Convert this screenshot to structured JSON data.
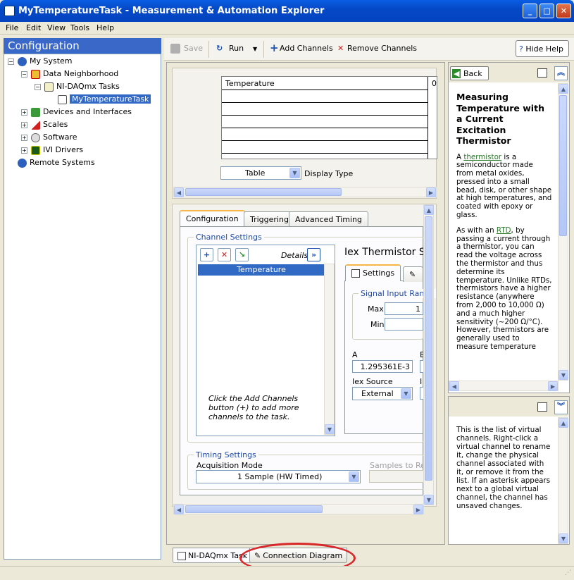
{
  "window": {
    "title": "MyTemperatureTask - Measurement & Automation Explorer"
  },
  "menu": [
    "File",
    "Edit",
    "View",
    "Tools",
    "Help"
  ],
  "left": {
    "header": "Configuration",
    "tree": [
      {
        "label": "My System",
        "icon": "system-icon"
      },
      {
        "label": "Data Neighborhood",
        "icon": "data-neighborhood-icon"
      },
      {
        "label": "NI-DAQmx Tasks",
        "icon": "daqmx-tasks-icon"
      },
      {
        "label": "MyTemperatureTask",
        "icon": "task-icon"
      },
      {
        "label": "Devices and Interfaces",
        "icon": "devices-icon"
      },
      {
        "label": "Scales",
        "icon": "scales-icon"
      },
      {
        "label": "Software",
        "icon": "software-icon"
      },
      {
        "label": "IVI Drivers",
        "icon": "ivi-icon"
      },
      {
        "label": "Remote Systems",
        "icon": "remote-systems-icon"
      }
    ]
  },
  "toolbar": {
    "save": "Save",
    "run": "Run",
    "add_channels": "Add Channels",
    "remove_channels": "Remove Channels",
    "hide_help": "Hide Help"
  },
  "display": {
    "column_header": "Temperature",
    "column_value": "0",
    "display_type_value": "Table",
    "display_type_label": "Display Type"
  },
  "config": {
    "tabs": [
      "Configuration",
      "Triggering",
      "Advanced Timing"
    ],
    "channel_settings": "Channel Settings",
    "details": "Details",
    "channel": "Temperature",
    "hint": "Click the Add Channels button (+) to add more channels to the task.",
    "iex_title": "Iex Thermistor S",
    "settings_tab": "Settings",
    "signal_range": "Signal Input Range",
    "max_label": "Max",
    "max_value": "1",
    "min_label": "Min",
    "min_value": "",
    "a_label": "A",
    "a_value": "1.295361E-3",
    "b_label": "E",
    "iex_source_label": "Iex Source",
    "iex_source_value": "External",
    "i_label": "I",
    "timing_settings": "Timing Settings",
    "acq_mode_label": "Acquisition Mode",
    "acq_mode_value": "1 Sample (HW Timed)",
    "samples_label": "Samples to Rea"
  },
  "help": {
    "back": "Back",
    "heading": "Measuring Temperature with a Current Excitation Thermistor",
    "p1_pre": "A ",
    "p1_link": "thermistor",
    "p1_post": " is a semiconductor made from metal oxides, pressed into a small bead, disk, or other shape at high temperatures, and coated with epoxy or glass.",
    "p2_pre": "As with an ",
    "p2_link": "RTD",
    "p2_post": ", by passing a current through a thermistor, you can read the voltage across the thermistor and thus determine its temperature. Unlike RTDs, thermistors have a higher resistance (anywhere from 2,000 to 10,000 Ω) and a much higher sensitivity (~200 Ω/°C). However, thermistors are generally used to measure temperature",
    "context": "This is the list of virtual channels. Right-click a virtual channel to rename it, change the physical channel associated with it, or remove it from the list. If an asterisk appears next to a global virtual channel, the channel has unsaved changes."
  },
  "bottom_tabs": [
    "NI-DAQmx Task",
    "Connection Diagram"
  ],
  "colors": {
    "title_bar": "#0549c7",
    "selection": "#316ac5",
    "highlight_ellipse": "#d9282c"
  }
}
